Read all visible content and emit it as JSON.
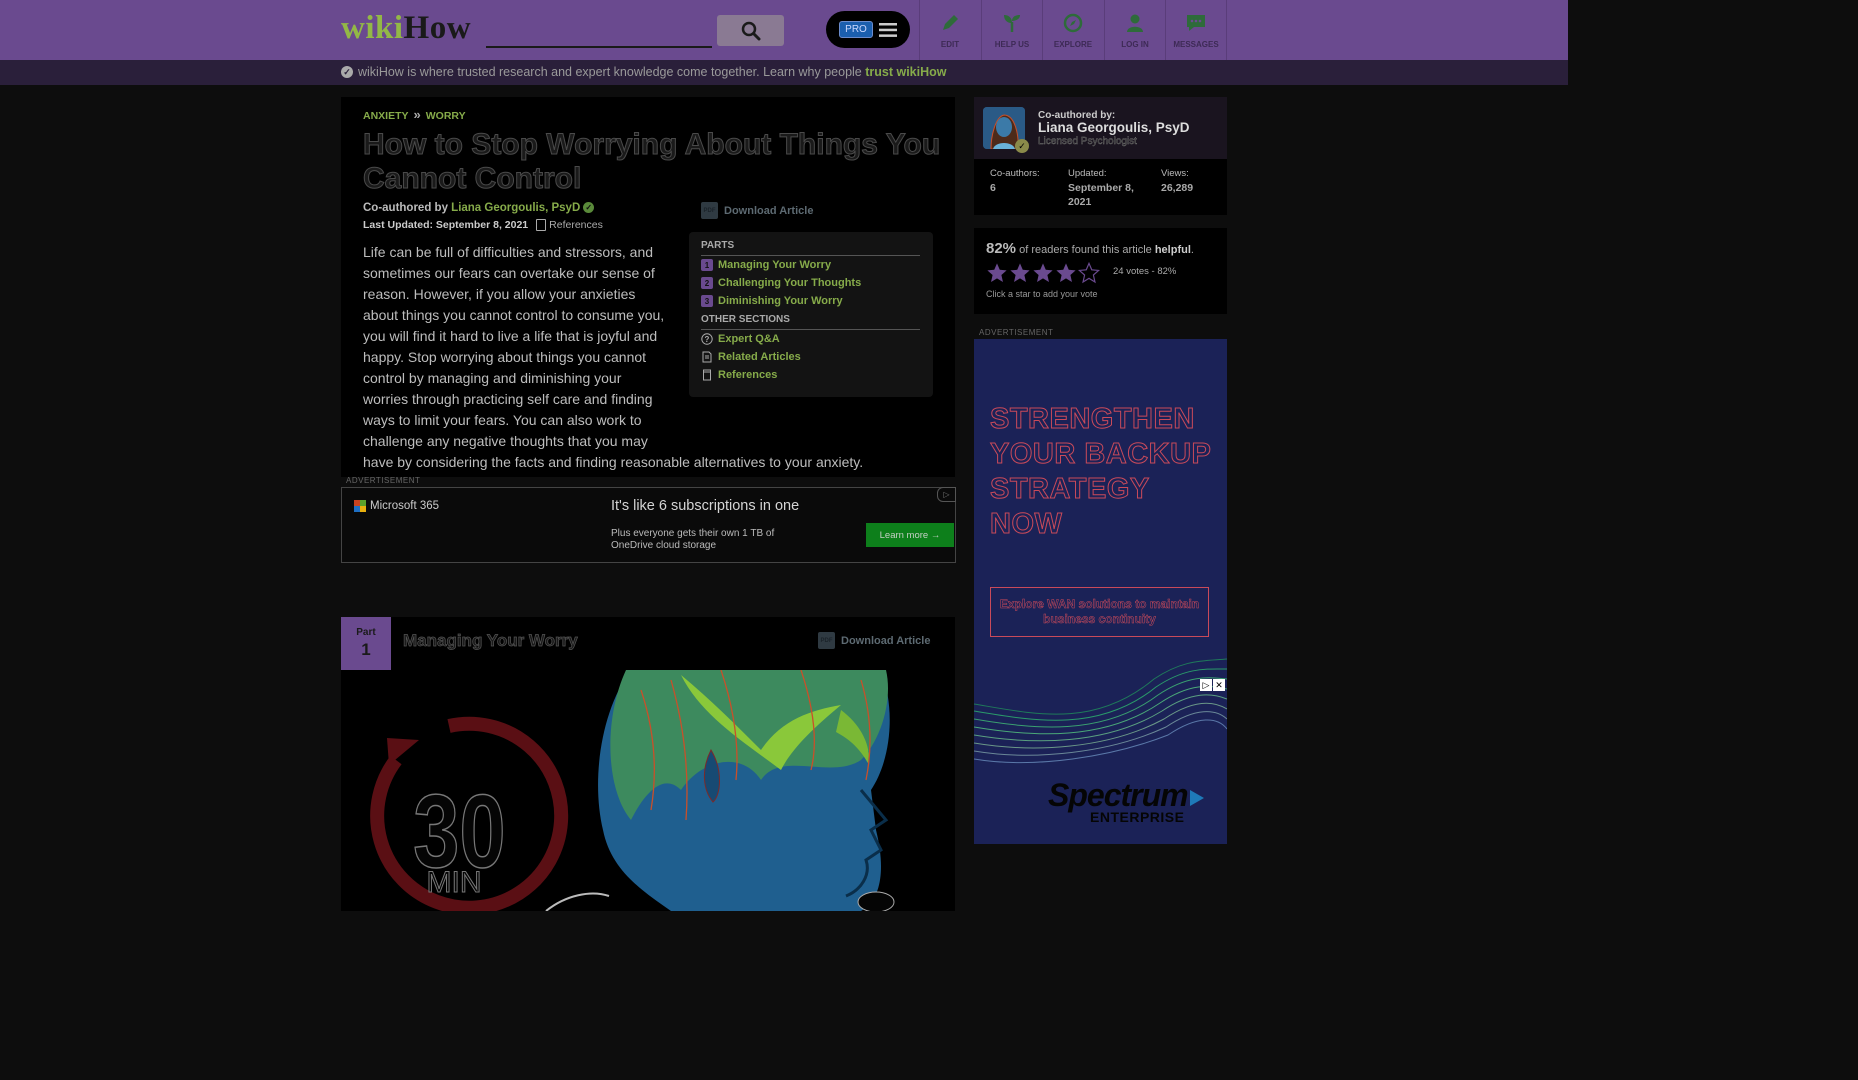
{
  "header": {
    "logo_part1": "wiki",
    "logo_part2": "How",
    "search_value": "",
    "pro_label": "PRO",
    "nav": [
      {
        "label": "EDIT",
        "icon": "pencil-icon"
      },
      {
        "label": "HELP US",
        "icon": "sprout-icon"
      },
      {
        "label": "EXPLORE",
        "icon": "compass-icon"
      },
      {
        "label": "LOG IN",
        "icon": "user-icon"
      },
      {
        "label": "MESSAGES",
        "icon": "chat-icon"
      }
    ]
  },
  "trust": {
    "text": "wikiHow is where trusted research and expert knowledge come together. Learn why people ",
    "link": "trust wikiHow"
  },
  "breadcrumb": [
    "ANXIETY",
    "WORRY"
  ],
  "breadcrumb_sep": "»",
  "article": {
    "title": "How to Stop Worrying About Things You Cannot Control",
    "coauthored_prefix": "Co-authored by ",
    "author": "Liana Georgoulis, PsyD",
    "updated": "Last Updated: September 8, 2021",
    "references_label": "References",
    "download_label": "Download Article",
    "intro": "Life can be full of difficulties and stressors, and sometimes our fears can overtake our sense of reason. However, if you allow your anxieties about things you cannot control to consume you, you will find it hard to live a life that is joyful and happy. Stop worrying about things you cannot control by managing and diminishing your worries through practicing self care and finding ways to limit your fears. You can also work to challenge any negative thoughts that you may have by considering the facts and finding reasonable alternatives to your anxiety."
  },
  "toc": {
    "parts_heading": "PARTS",
    "parts": [
      {
        "num": "1",
        "label": "Managing Your Worry"
      },
      {
        "num": "2",
        "label": "Challenging Your Thoughts"
      },
      {
        "num": "3",
        "label": "Diminishing Your Worry"
      }
    ],
    "other_heading": "OTHER SECTIONS",
    "other": [
      {
        "label": "Expert Q&A",
        "icon": "question-icon"
      },
      {
        "label": "Related Articles",
        "icon": "document-icon"
      },
      {
        "label": "References",
        "icon": "book-icon"
      }
    ]
  },
  "ad_label": "ADVERTISEMENT",
  "ms_ad": {
    "brand": "Microsoft 365",
    "headline": "It's like 6 subscriptions in one",
    "sub": "Plus everyone gets their own 1 TB of OneDrive cloud storage",
    "cta": "Learn more →"
  },
  "part1": {
    "label": "Part",
    "num": "1",
    "title": "Managing Your Worry",
    "download_label": "Download Article",
    "image_text_top": "30",
    "image_text_bottom": "MIN"
  },
  "sidebar": {
    "coauthored_label": "Co-authored by:",
    "author": "Liana Georgoulis, PsyD",
    "credential": "Licensed Psychologist",
    "stats": [
      {
        "label": "Co-authors:",
        "value": "6"
      },
      {
        "label": "Updated:",
        "value": "September 8, 2021"
      },
      {
        "label": "Views:",
        "value": "26,289"
      }
    ],
    "rating": {
      "percent": "82%",
      "text_middle": " of readers found this article ",
      "helpful": "helpful",
      "period": ".",
      "votes": "24 votes - 82%",
      "hint": "Click a star to add your vote",
      "stars_filled": 4,
      "stars_total": 5
    },
    "ad_label": "ADVERTISEMENT",
    "ad": {
      "headline": "STRENGTHEN YOUR BACKUP STRATEGY NOW",
      "button": "Explore WAN solutions to maintain business continuity",
      "brand": "Spectrum",
      "brand_sub": "ENTERPRISE"
    }
  },
  "colors": {
    "header_bg": "#6a4a8f",
    "link_green": "#86ab4a",
    "ms_cta": "#0d7f1b",
    "ad_bg": "#1b2257"
  }
}
